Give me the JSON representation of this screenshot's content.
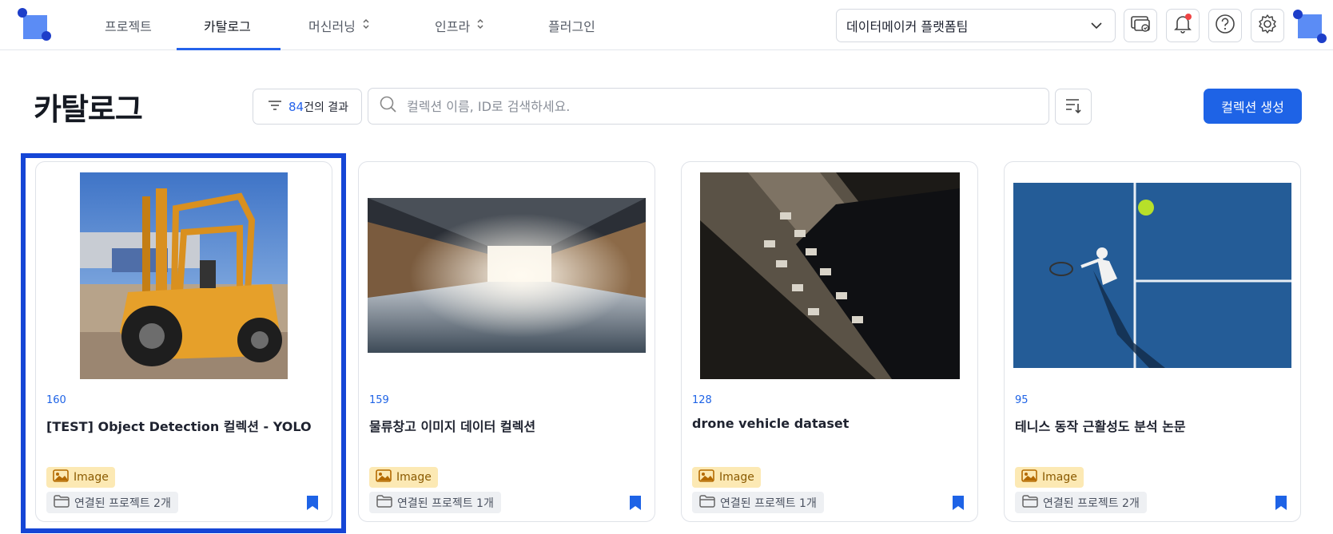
{
  "nav": {
    "items": [
      {
        "label": "프로젝트",
        "dropdown": false
      },
      {
        "label": "카탈로그",
        "dropdown": false,
        "active": true
      },
      {
        "label": "머신러닝",
        "dropdown": true
      },
      {
        "label": "인프라",
        "dropdown": true
      },
      {
        "label": "플러그인",
        "dropdown": false
      }
    ],
    "chevron": "⌃⌄",
    "platform_select": "데이터메이커 플랫폼팀",
    "icons": [
      "workspace-icon",
      "bell-icon",
      "help-icon",
      "gear-icon"
    ],
    "notification_dot_color": "#ef4444"
  },
  "header": {
    "title": "카탈로그",
    "filter": {
      "count": "84",
      "suffix": "건의 결과"
    },
    "search": {
      "placeholder": "컬렉션 이름, ID로 검색하세요."
    },
    "create_button": "컬렉션 생성"
  },
  "colors": {
    "accent": "#1e63e6",
    "selection": "#1546d6",
    "image_badge_bg": "#fce9b4"
  },
  "cards": [
    {
      "count": "160",
      "title": "[TEST] Object Detection 컬렉션 - YOLO",
      "type": "Image",
      "projects": "연결된 프로젝트 2개",
      "thumbnail": "forklift-photo",
      "selected": true
    },
    {
      "count": "159",
      "title": "물류창고 이미지 데이터 컬렉션",
      "type": "Image",
      "projects": "연결된 프로젝트 1개",
      "thumbnail": "warehouse-photo"
    },
    {
      "count": "128",
      "title": "drone vehicle dataset",
      "type": "Image",
      "projects": "연결된 프로젝트 1개",
      "thumbnail": "drone-parking-photo"
    },
    {
      "count": "95",
      "title": "테니스 동작 근활성도 분석 논문",
      "type": "Image",
      "projects": "연결된 프로젝트 2개",
      "thumbnail": "tennis-photo"
    }
  ]
}
